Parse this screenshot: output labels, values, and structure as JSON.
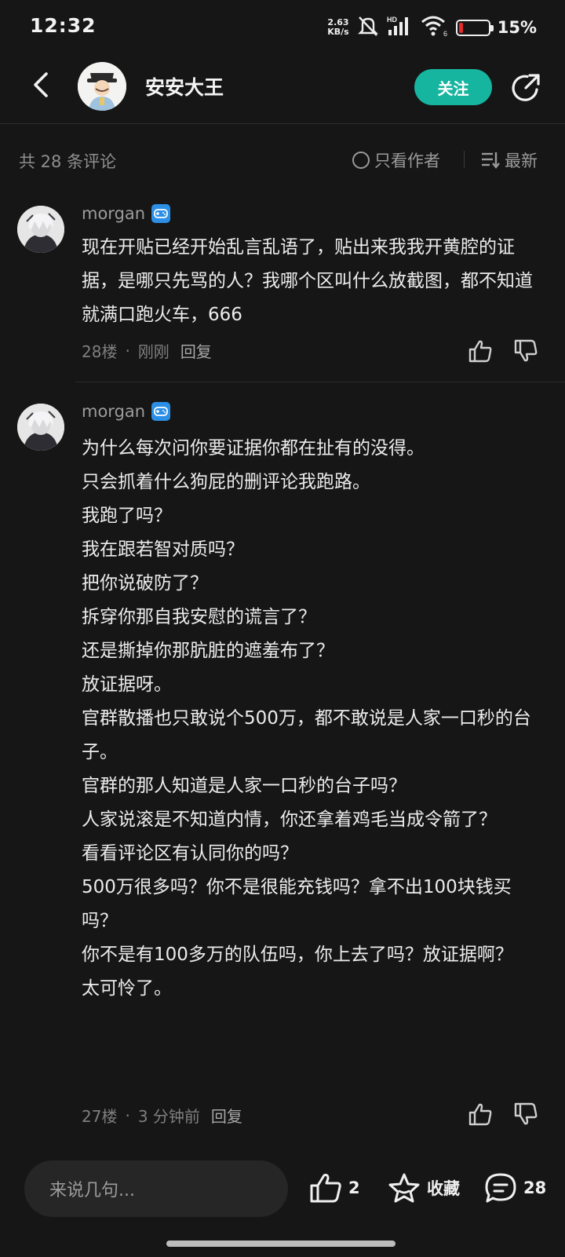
{
  "status_bar": {
    "time": "12:32",
    "net_speed_value": "2.63",
    "net_speed_unit": "KB/s",
    "signal_label": "HD",
    "wifi_sub": "6",
    "battery_percent": "15%",
    "battery_level": 0.15,
    "battery_color": "#e52b2b"
  },
  "header": {
    "title": "安安大王",
    "follow_label": "关注",
    "accent_color": "#15b59f"
  },
  "filter": {
    "count_label": "共 28 条评论",
    "only_author_label": "只看作者",
    "sort_label": "最新"
  },
  "comments": [
    {
      "username": "morgan",
      "lines": [
        "现在开贴已经开始乱言乱语了，贴出来我我开黄腔的证据，是哪只先骂的人？我哪个区叫什么放截图，都不知道就满口跑火车，666"
      ],
      "floor": "28楼",
      "time": "刚刚",
      "reply_label": "回复"
    },
    {
      "username": "morgan",
      "lines": [
        "为什么每次问你要证据你都在扯有的没得。",
        "只会抓着什么狗屁的删评论我跑路。",
        "我跑了吗？",
        "我在跟若智对质吗？",
        "把你说破防了？",
        "拆穿你那自我安慰的谎言了？",
        "还是撕掉你那肮脏的遮羞布了？",
        "放证据呀。",
        "官群散播也只敢说个500万，都不敢说是人家一口秒的台子。",
        "官群的那人知道是人家一口秒的台子吗？",
        "人家说滚是不知道内情，你还拿着鸡毛当成令箭了？",
        "看看评论区有认同你的吗？",
        "500万很多吗？你不是很能充钱吗？拿不出100块钱买吗？",
        "你不是有100多万的队伍吗，你上去了吗？放证据啊？",
        "太可怜了。"
      ],
      "floor": "27楼",
      "time": "3 分钟前",
      "reply_label": "回复"
    }
  ],
  "meta_separator": "·",
  "bottom_bar": {
    "input_placeholder": "来说几句...",
    "like_count": "2",
    "favorite_label": "收藏",
    "comment_count": "28"
  },
  "icons": {
    "back": "chevron-left-icon",
    "share": "share-icon",
    "thumb_up": "thumb-up-icon",
    "thumb_down": "thumb-down-icon",
    "star": "star-icon",
    "comment": "comment-bubble-icon",
    "sort": "sort-lines-icon",
    "game_badge": "game-controller-icon"
  }
}
